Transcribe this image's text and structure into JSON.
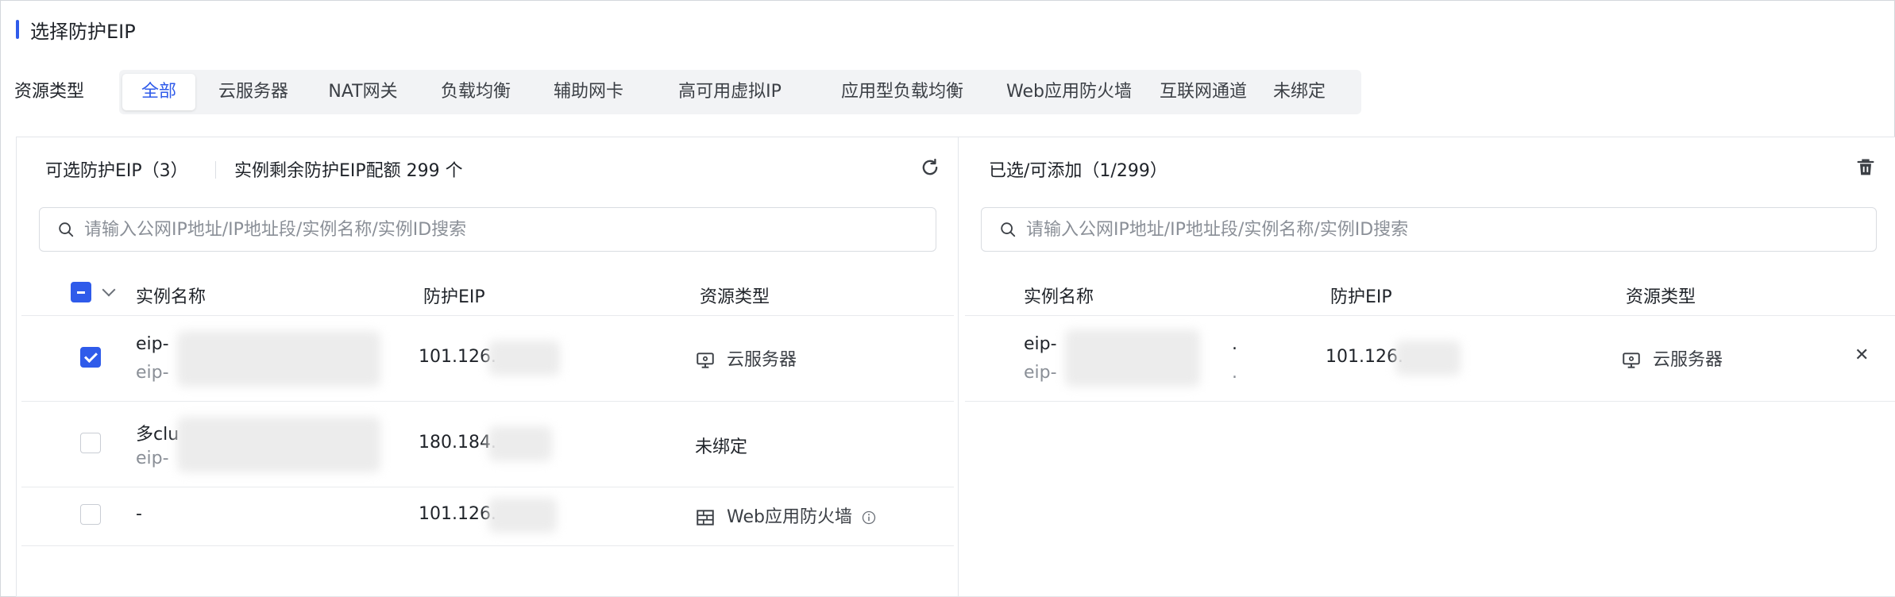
{
  "dialog": {
    "title": "选择防护EIP"
  },
  "filter": {
    "label": "资源类型",
    "tabs": [
      {
        "label": "全部",
        "active": true
      },
      {
        "label": "云服务器"
      },
      {
        "label": "NAT网关"
      },
      {
        "label": "负载均衡"
      },
      {
        "label": "辅助网卡"
      },
      {
        "label": "高可用虚拟IP"
      },
      {
        "label": "应用型负载均衡"
      },
      {
        "label": "Web应用防火墙"
      },
      {
        "label": "互联网通道"
      },
      {
        "label": "未绑定"
      }
    ]
  },
  "left_panel": {
    "title": "可选防护EIP（3）",
    "quota_prefix": "实例剩余防护EIP配额",
    "quota_value": "299",
    "quota_unit": "个",
    "search_placeholder": "请输入公网IP地址/IP地址段/实例名称/实例ID搜索",
    "columns": [
      "实例名称",
      "防护EIP",
      "资源类型"
    ],
    "header_checkbox_state": "indeterminate",
    "rows": [
      {
        "name": "eip-",
        "sub": "eip-",
        "eip": "101.126.",
        "type": "云服务器",
        "type_icon": "monitor-icon",
        "checked": true
      },
      {
        "name": "多clu",
        "sub": "eip-",
        "eip": "180.184.",
        "type": "未绑定",
        "type_icon": "",
        "checked": false
      },
      {
        "name": "-",
        "sub": "",
        "eip": "101.126.",
        "type": "Web应用防火墙",
        "type_icon": "firewall-icon",
        "checked": false
      }
    ]
  },
  "right_panel": {
    "title": "已选/可添加（1/299）",
    "search_placeholder": "请输入公网IP地址/IP地址段/实例名称/实例ID搜索",
    "columns": [
      "实例名称",
      "防护EIP",
      "资源类型"
    ],
    "rows": [
      {
        "name": "eip-",
        "sub": "eip-",
        "eip": "101.126.",
        "type": "云服务器",
        "type_icon": "monitor-icon",
        "name_trail": ".",
        "sub_trail": "."
      }
    ]
  },
  "colors": {
    "accent": "#2f5bea",
    "muted_text": "#8a8f97",
    "tab_bg": "#f2f3f5"
  }
}
